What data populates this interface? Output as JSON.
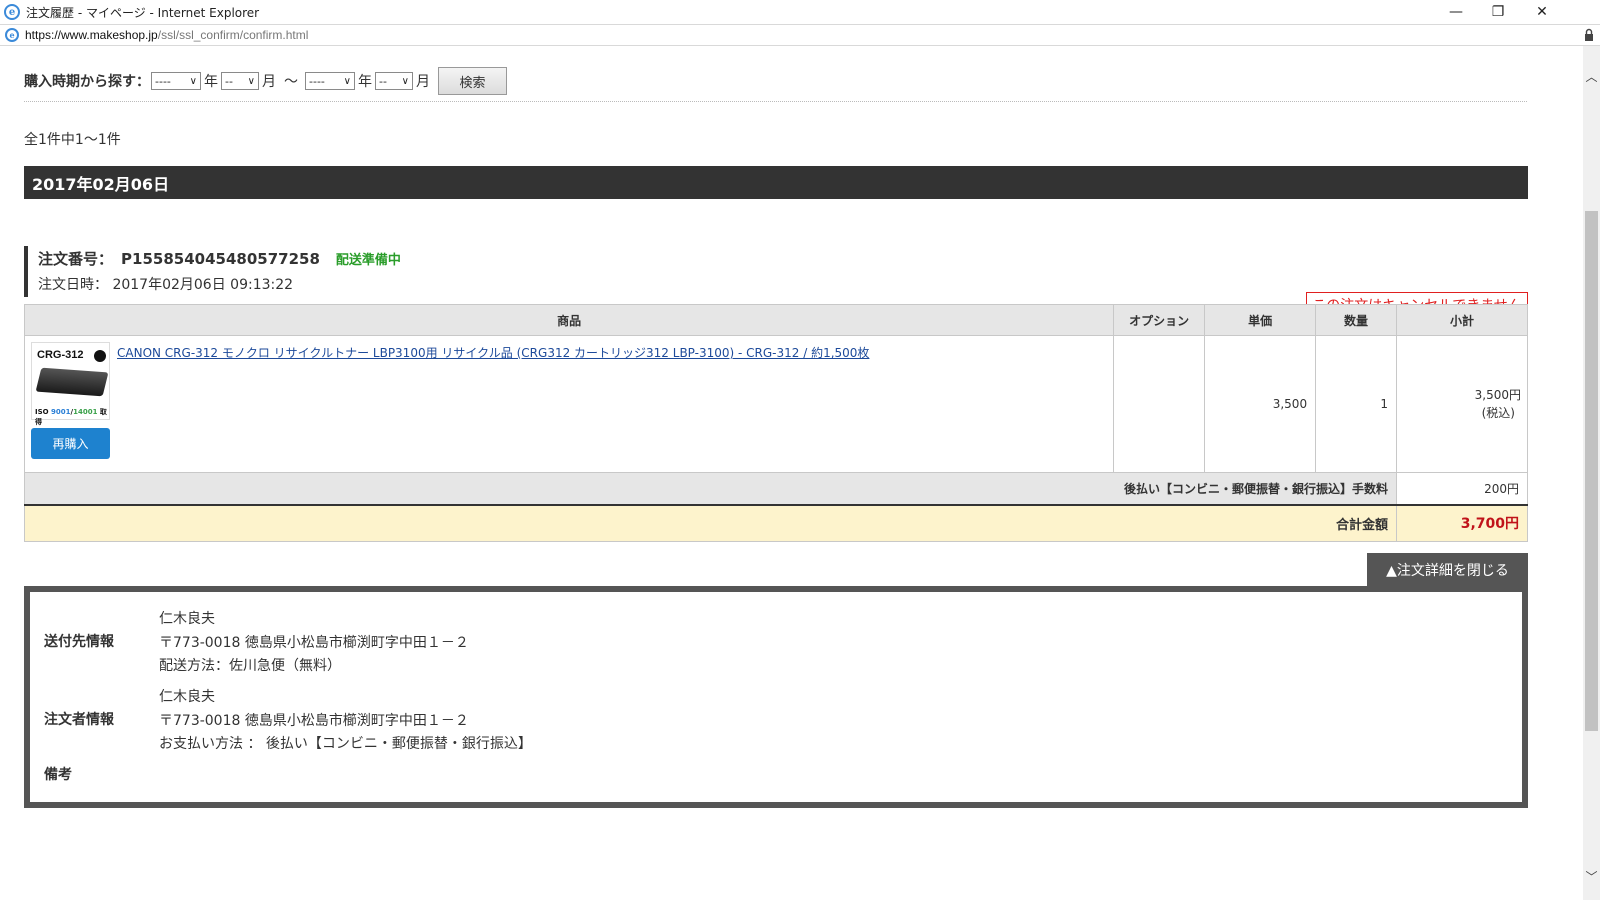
{
  "window": {
    "title": "注文履歴 - マイページ - Internet Explorer",
    "minimize_glyph": "—",
    "restore_glyph": "❐",
    "close_glyph": "✕"
  },
  "address": {
    "domain": "https://www.makeshop.jp",
    "path": "/ssl/ssl_confirm/confirm.html"
  },
  "search": {
    "label": "購入時期から探す：",
    "year_from": "----",
    "month_from": "--",
    "year_to": "----",
    "month_to": "--",
    "year_unit": "年",
    "month_unit": "月",
    "tilde": "～",
    "button": "検索"
  },
  "result_count": "全1件中1～1件",
  "date_header": "2017年02月06日",
  "order": {
    "number_label": "注文番号：",
    "number": "P155854045480577258",
    "status": "配送準備中",
    "date_label": "注文日時：",
    "date": "2017年02月06日 09:13:22",
    "cancel_note": "この注文はキャンセルできません"
  },
  "table": {
    "headers": [
      "商品",
      "オプション",
      "単価",
      "数量",
      "小計"
    ],
    "item": {
      "image_label": "CRG-312",
      "image_cert": [
        "ISO",
        "9001",
        "/",
        "14001",
        "取得"
      ],
      "name": "CANON CRG-312 モノクロ リサイクルトナー LBP3100用 リサイクル品 (CRG312 カートリッジ312 LBP-3100) - CRG-312 / 約1,500枚",
      "option": "",
      "unit_price": "3,500",
      "quantity": "1",
      "subtotal": "3,500円",
      "tax_note": "(税込)",
      "rebuy_button": "再購入"
    },
    "fee_label": "後払い【コンビニ・郵便振替・銀行振込】手数料",
    "fee_value": "200円",
    "total_label": "合計金額",
    "total_value": "3,700円"
  },
  "close_details_button": "▲注文詳細を閉じる",
  "details": {
    "shipping_label": "送付先情報",
    "shipping_lines": [
      "仁木良夫",
      "〒773-0018 徳島県小松島市櫛渕町字中田１－２",
      "配送方法：佐川急便（無料）"
    ],
    "orderer_label": "注文者情報",
    "orderer_lines": [
      "仁木良夫",
      "〒773-0018 徳島県小松島市櫛渕町字中田１－２",
      "お支払い方法 ： 後払い【コンビニ・郵便振替・銀行振込】"
    ],
    "notes_label": "備考"
  },
  "colors": {
    "header_bg": "#333333",
    "status_green": "#2a9d2a",
    "cancel_red": "#e02020",
    "rebuy_blue": "#1e82cf",
    "total_bg": "#fdf3cc",
    "total_red": "#c0131a"
  }
}
